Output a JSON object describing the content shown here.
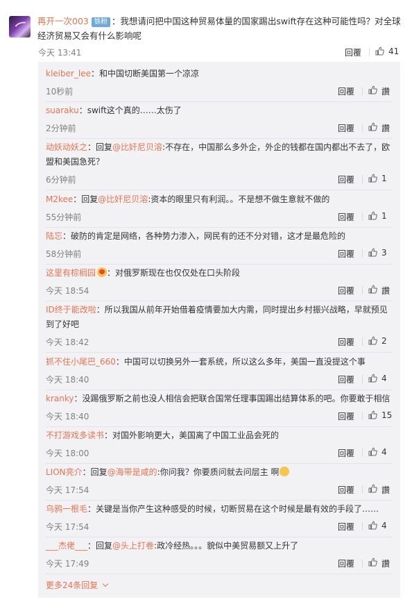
{
  "main_comment": {
    "username": "再开一次003",
    "badge": "铁粉",
    "text": "：我想请问把中国这种贸易体量的国家踢出swift存在这种可能性吗？对全球经济贸易又会有什么影响呢",
    "time": "今天 13:41",
    "reply_label": "回覆",
    "like_count": "41"
  },
  "replies": [
    {
      "user": "kleiber_lee",
      "at": "",
      "text": "：和中国切断美国第一个凉凉",
      "time": "10秒前",
      "reply": "回覆",
      "likes": "讚",
      "emoji": ""
    },
    {
      "user": "suaraku",
      "at": "",
      "text": "：swift这个真的……太伤了",
      "time": "2分钟前",
      "reply": "回覆",
      "likes": "讚",
      "emoji": ""
    },
    {
      "user": "动妖动妖之",
      "at": "@比奸尼贝溶",
      "pre": "：回复",
      "text": ":不存在，中国那么多外企，外企的钱都在国内都出不去了，欧盟和美国急死？",
      "time": "6分钟前",
      "reply": "回覆",
      "likes": "1",
      "emoji": ""
    },
    {
      "user": "M2kee",
      "at": "@比奸尼贝溶",
      "pre": "：回复",
      "text": ":资本的眼里只有利润。。不是想不做生意就不做的",
      "time": "55分钟前",
      "reply": "回覆",
      "likes": "1",
      "emoji": ""
    },
    {
      "user": "陆忘",
      "at": "",
      "text": "：破防的肯定是网络，各种势力渗入，网民有的还不分对错，这才是最危险的",
      "time": "58分钟前",
      "reply": "回覆",
      "likes": "3",
      "emoji": ""
    },
    {
      "user": "这里有棕榈园",
      "at": "",
      "text": "：对俄罗斯现在也仅仅处在口头阶段",
      "time": "今天 18:54",
      "reply": "回覆",
      "likes": "讚",
      "emoji": "heart"
    },
    {
      "user": "ID终于能改啦",
      "at": "",
      "text": "：所以我国从前年开始借着疫情要加大内需，同时提出乡村振兴战略，早就预见到了好吧",
      "time": "今天 18:42",
      "reply": "回覆",
      "likes": "2",
      "emoji": ""
    },
    {
      "user": "抓不住小尾巴_660",
      "at": "",
      "text": "：中国可以切换另外一套系统，所以这么多年，美国一直没提这个事",
      "time": "今天 18:40",
      "reply": "回覆",
      "likes": "4",
      "emoji": ""
    },
    {
      "user": "kranky",
      "at": "",
      "text": "：没踢俄罗斯之前也没人相信会把联合国常任理事国踢出结算体系的吧。你要敢于相信",
      "time": "今天 18:40",
      "reply": "回覆",
      "likes": "15",
      "emoji": ""
    },
    {
      "user": "不打游戏多读书",
      "at": "",
      "text": "：对国外影响更大，美国离了中国工业品会死的",
      "time": "今天 18:00",
      "reply": "回覆",
      "likes": "4",
      "emoji": ""
    },
    {
      "user": "LION亮介",
      "at": "@海带是咸的",
      "pre": "：回复",
      "text": ":你问我？你要质问就去问层主 啊",
      "time": "今天 17:54",
      "reply": "回覆",
      "likes": "讚",
      "emoji": "smile"
    },
    {
      "user": "乌鸦一根毛",
      "at": "",
      "text": "：关键是当你产生这种感受的时候，切断贸易在这个时候是最有效的手段了……",
      "time": "今天 17:54",
      "reply": "回覆",
      "likes": "4",
      "emoji": ""
    },
    {
      "user": "___杰佬___",
      "at": "@头上打卷",
      "pre": "：回复",
      "text": ":政冷经热。。。貌似中美贸易额又上升了",
      "time": "今天 17:49",
      "reply": "回覆",
      "likes": "讚",
      "emoji": ""
    }
  ],
  "more_link": "更多24条回复",
  "colors": {
    "accent": "#eb7350",
    "panel": "#f2f2f5",
    "meta": "#808080"
  }
}
